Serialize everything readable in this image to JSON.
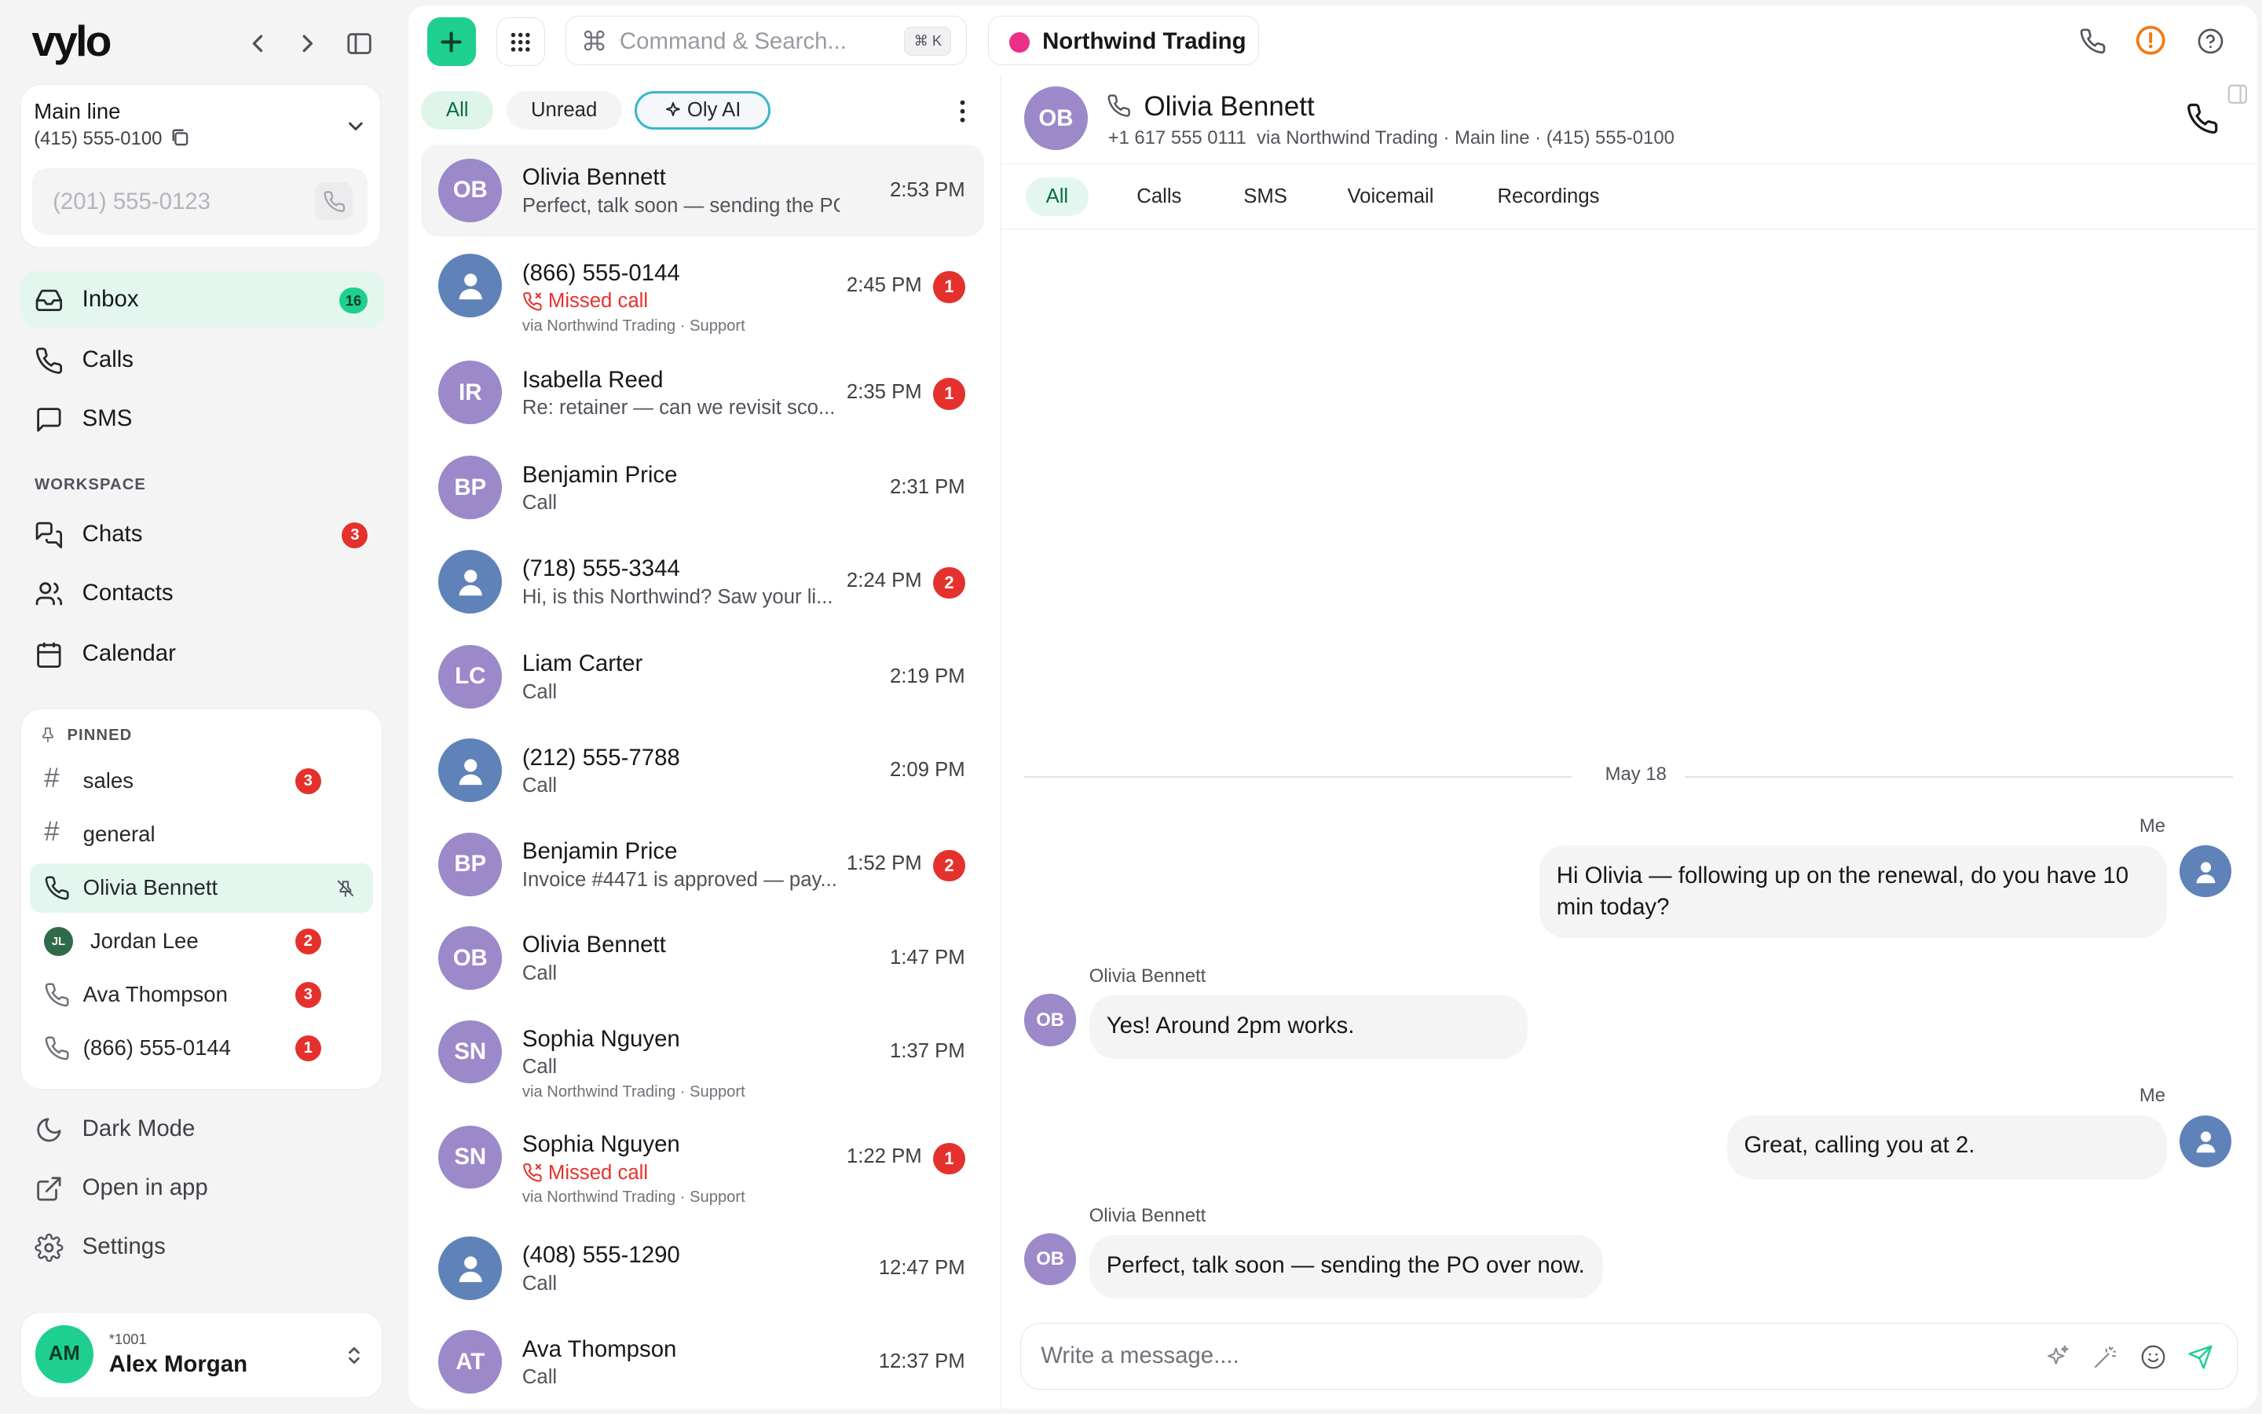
{
  "sidebar": {
    "logo": "vylo",
    "line": {
      "name": "Main line",
      "number": "(415) 555-0100"
    },
    "dial_placeholder": "(201) 555-0123",
    "nav": [
      {
        "label": "Inbox",
        "badge": "16",
        "icon": "inbox-icon"
      },
      {
        "label": "Calls",
        "icon": "phone-icon"
      },
      {
        "label": "SMS",
        "icon": "message-icon"
      }
    ],
    "workspace_label": "WORKSPACE",
    "workspace_nav": [
      {
        "label": "Chats",
        "badge": "3",
        "icon": "chats-icon"
      },
      {
        "label": "Contacts",
        "icon": "contacts-icon"
      },
      {
        "label": "Calendar",
        "icon": "calendar-icon"
      }
    ],
    "pinned_label": "PINNED",
    "pinned": [
      {
        "label": "sales",
        "badge": "3",
        "icon": "hash-icon"
      },
      {
        "label": "general",
        "icon": "hash-icon"
      },
      {
        "label": "Olivia Bennett",
        "icon": "phone-icon",
        "active": true
      },
      {
        "label": "Jordan Lee",
        "badge": "2",
        "initials": "JL"
      },
      {
        "label": "Ava Thompson",
        "badge": "3",
        "icon": "phone-icon"
      },
      {
        "label": "(866) 555-0144",
        "badge": "1",
        "icon": "phone-icon"
      }
    ],
    "bottom": [
      {
        "label": "Dark Mode",
        "icon": "moon-icon"
      },
      {
        "label": "Open in app",
        "icon": "external-link-icon"
      },
      {
        "label": "Settings",
        "icon": "gear-icon"
      }
    ],
    "user": {
      "initials": "AM",
      "ext": "*1001",
      "name": "Alex Morgan"
    }
  },
  "topbar": {
    "search_placeholder": "Command & Search...",
    "shortcut": "⌘ K",
    "workspace_name": "Northwind Trading"
  },
  "list": {
    "filters": [
      "All",
      "Unread",
      "Oly AI"
    ],
    "conversations": [
      {
        "initials": "OB",
        "name": "Olivia Bennett",
        "sub": "Perfect, talk soon — sending the PO ...",
        "time": "2:53 PM",
        "selected": true
      },
      {
        "initials": "",
        "name": "(866) 555-0144",
        "sub": "Missed call",
        "missed": true,
        "via": "via Northwind Trading · Support",
        "time": "2:45 PM",
        "badge": "1"
      },
      {
        "initials": "IR",
        "name": "Isabella Reed",
        "sub": "Re: retainer — can we revisit sco...",
        "time": "2:35 PM",
        "badge": "1"
      },
      {
        "initials": "BP",
        "name": "Benjamin Price",
        "sub": "Call",
        "time": "2:31 PM"
      },
      {
        "initials": "",
        "name": "(718) 555-3344",
        "sub": "Hi, is this Northwind? Saw your li...",
        "time": "2:24 PM",
        "badge": "2"
      },
      {
        "initials": "LC",
        "name": "Liam Carter",
        "sub": "Call",
        "time": "2:19 PM"
      },
      {
        "initials": "",
        "name": "(212) 555-7788",
        "sub": "Call",
        "time": "2:09 PM"
      },
      {
        "initials": "BP",
        "name": "Benjamin Price",
        "sub": "Invoice #4471 is approved — pay...",
        "time": "1:52 PM",
        "badge": "2"
      },
      {
        "initials": "OB",
        "name": "Olivia Bennett",
        "sub": "Call",
        "time": "1:47 PM"
      },
      {
        "initials": "SN",
        "name": "Sophia Nguyen",
        "sub": "Call",
        "via": "via Northwind Trading · Support",
        "time": "1:37 PM"
      },
      {
        "initials": "SN",
        "name": "Sophia Nguyen",
        "sub": "Missed call",
        "missed": true,
        "via": "via Northwind Trading · Support",
        "time": "1:22 PM",
        "badge": "1"
      },
      {
        "initials": "",
        "name": "(408) 555-1290",
        "sub": "Call",
        "time": "12:47 PM"
      },
      {
        "initials": "AT",
        "name": "Ava Thompson",
        "sub": "Call",
        "time": "12:37 PM"
      }
    ]
  },
  "detail": {
    "initials": "OB",
    "name": "Olivia Bennett",
    "meta": "+1 617 555 0111  via Northwind Trading · Main line · (415) 555-0100",
    "tabs": [
      "All",
      "Calls",
      "SMS",
      "Voicemail",
      "Recordings"
    ],
    "date": "May 18",
    "messages": [
      {
        "from": "Me",
        "text": "Hi Olivia — following up on the renewal, do you have 10 min today?"
      },
      {
        "from": "Olivia Bennett",
        "initials": "OB",
        "text": "Yes! Around 2pm works."
      },
      {
        "from": "Me",
        "text": "Great, calling you at 2."
      },
      {
        "from": "Olivia Bennett",
        "initials": "OB",
        "text": "Perfect, talk soon — sending the PO over now."
      }
    ],
    "composer_placeholder": "Write a message...."
  },
  "colors": {
    "accent": "#1fcf8f",
    "badge": "#e5312d",
    "avatar": "#9b89c9",
    "active_bg": "#e3f7ef"
  }
}
